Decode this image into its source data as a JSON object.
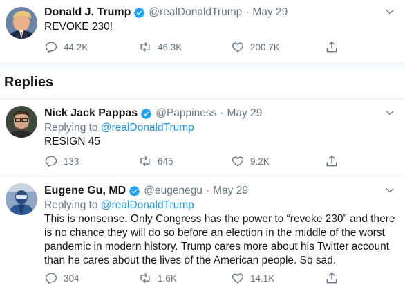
{
  "colors": {
    "accent": "#1b95e0",
    "muted": "#657786",
    "text": "#14171a"
  },
  "main_tweet": {
    "name": "Donald J. Trump",
    "handle": "@realDonaldTrump",
    "date": "May 29",
    "text": "REVOKE 230!",
    "replies": "44.2K",
    "retweets": "46.3K",
    "likes": "200.7K"
  },
  "replies_heading": "Replies",
  "replies": [
    {
      "name": "Nick Jack Pappas",
      "handle": "@Pappiness",
      "date": "May 29",
      "replying_prefix": "Replying to",
      "replying_to": "@realDonaldTrump",
      "text": "RESIGN 45",
      "replies": "133",
      "retweets": "645",
      "likes": "9.2K"
    },
    {
      "name": "Eugene Gu, MD",
      "handle": "@eugenegu",
      "date": "May 29",
      "replying_prefix": "Replying to",
      "replying_to": "@realDonaldTrump",
      "text": "This is nonsense. Only Congress has the power to “revoke 230” and there is no chance they will do so before an election in the middle of the worst pandemic in modern history. Trump cares more about his Twitter account than he cares about the lives of the American people. So sad.",
      "replies": "304",
      "retweets": "1.6K",
      "likes": "14.1K"
    }
  ],
  "separator": "·",
  "icons": {
    "verified": "verified-badge-icon",
    "reply": "reply-icon",
    "retweet": "retweet-icon",
    "like": "heart-icon",
    "share": "share-icon",
    "more": "chevron-down-icon"
  }
}
